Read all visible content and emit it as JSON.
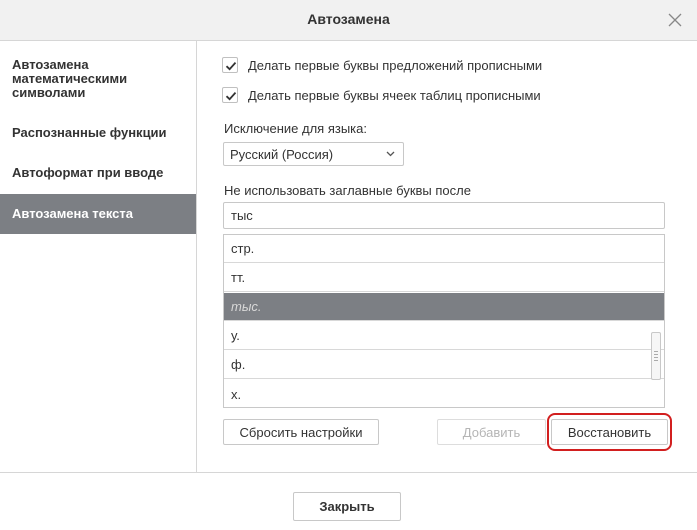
{
  "dialog": {
    "title": "Автозамена",
    "close_icon": "close-icon"
  },
  "sidebar": {
    "items": [
      {
        "label": "Автозамена математическими символами",
        "active": false
      },
      {
        "label": "Распознанные функции",
        "active": false
      },
      {
        "label": "Автоформат при вводе",
        "active": false
      },
      {
        "label": "Автозамена текста",
        "active": true
      }
    ]
  },
  "options": {
    "capitalize_sentences": {
      "label": "Делать первые буквы предложений прописными",
      "checked": true
    },
    "capitalize_table_cells": {
      "label": "Делать первые буквы ячеек таблиц прописными",
      "checked": true
    }
  },
  "language": {
    "label": "Исключение для языка:",
    "selected": "Русский (Россия)"
  },
  "exceptions": {
    "label": "Не использовать заглавные буквы после",
    "input_value": "тыс",
    "items": [
      "стр.",
      "тт.",
      "тыс.",
      "у.",
      "ф.",
      "х."
    ],
    "selected_index": 2
  },
  "buttons": {
    "reset": "Сбросить настройки",
    "add": "Добавить",
    "restore": "Восстановить",
    "close": "Закрыть"
  },
  "colors": {
    "selection": "#7c7f84",
    "highlight": "#d21f1f"
  }
}
